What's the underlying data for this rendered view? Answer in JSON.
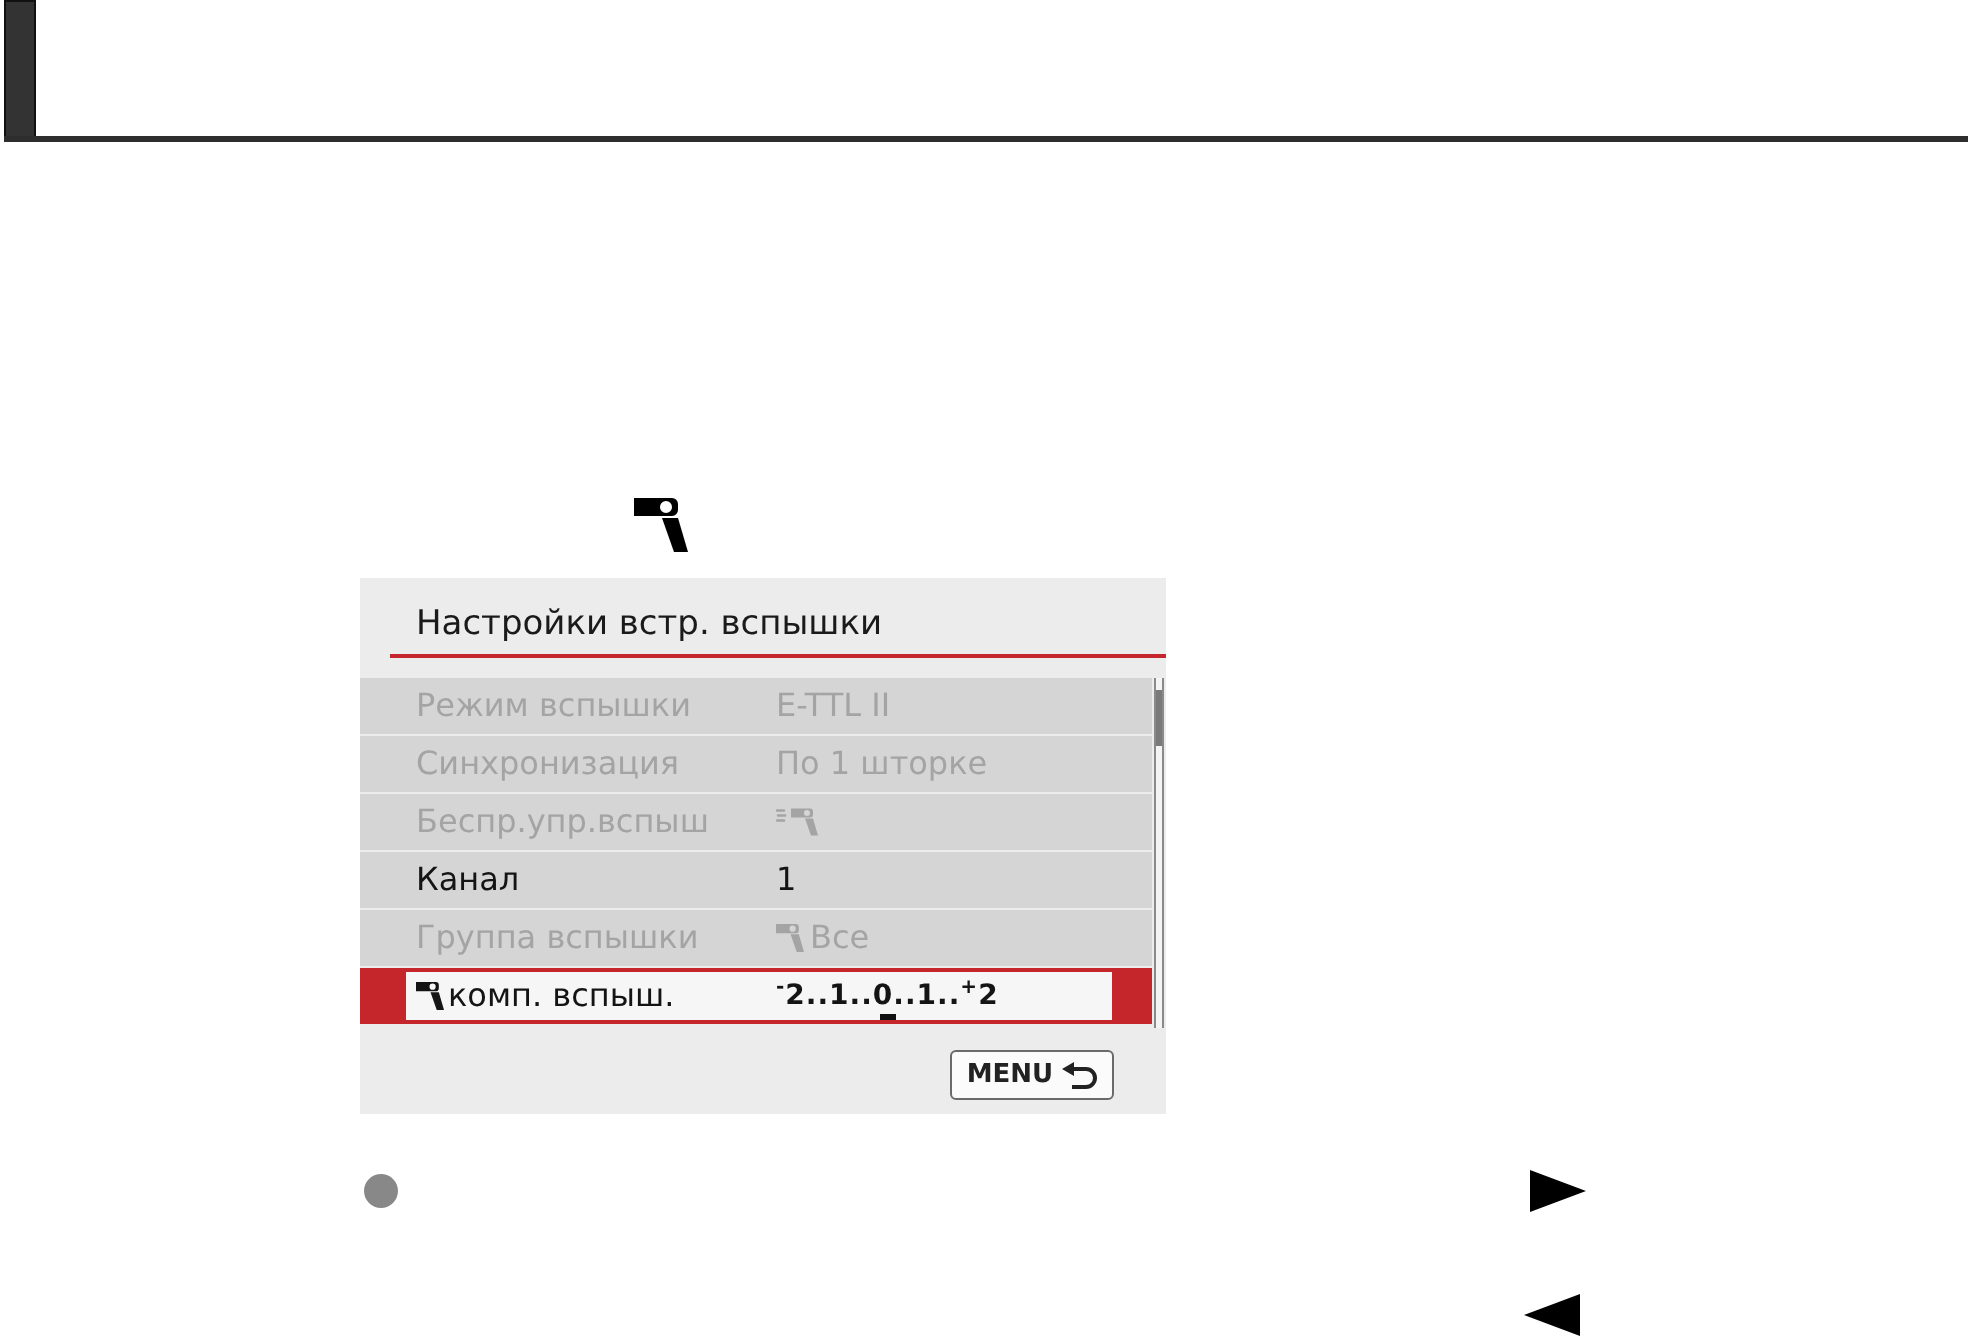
{
  "menu_screen": {
    "title": "Настройки встр. вспышки",
    "rows": [
      {
        "kind": "text",
        "label": "Режим вспышки",
        "value": "E-TTL II",
        "disabled": true,
        "selected": false
      },
      {
        "kind": "text",
        "label": "Синхронизация",
        "value": "По 1 шторке",
        "disabled": true,
        "selected": false
      },
      {
        "kind": "icon",
        "label": "Беспр.упр.вспыш",
        "disabled": true,
        "selected": false
      },
      {
        "kind": "text",
        "label": "Канал",
        "value": "1",
        "disabled": false,
        "selected": false
      },
      {
        "kind": "icontext",
        "label": "Группа вспышки",
        "value": "Все",
        "disabled": true,
        "selected": false
      },
      {
        "kind": "scale",
        "label": "комп. вспыш.",
        "value": "$^{-}$2..1..0..1..$^{+}$2",
        "level": 0.5,
        "disabled": false,
        "selected": true
      }
    ],
    "back_button": {
      "label": "MENU"
    }
  }
}
